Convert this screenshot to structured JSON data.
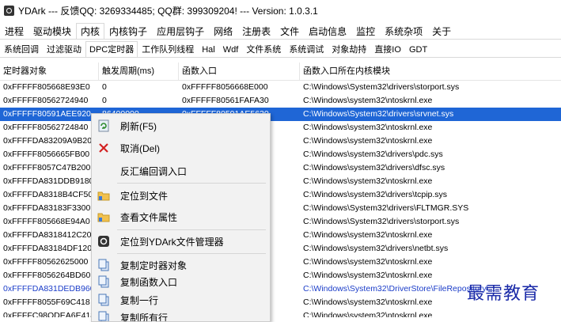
{
  "window": {
    "title": "YDArk --- 反馈QQ: 3269334485; QQ群: 399309204! --- Version: 1.0.3.1"
  },
  "menu": [
    "进程",
    "驱动模块",
    "内核",
    "内核钩子",
    "应用层钩子",
    "网络",
    "注册表",
    "文件",
    "启动信息",
    "监控",
    "系统杂项",
    "关于"
  ],
  "subtabs": [
    "系统回调",
    "过滤驱动",
    "DPC定时器",
    "工作队列线程",
    "Hal",
    "Wdf",
    "文件系统",
    "系统调试",
    "对象劫持",
    "直接IO",
    "GDT"
  ],
  "columns": [
    "定时器对象",
    "触发周期(ms)",
    "函数入口",
    "函数入口所在内核模块"
  ],
  "rows": [
    {
      "obj": "0xFFFFF805668E93E0",
      "period": "0",
      "entry": "0xFFFFF8056668E000",
      "module": "C:\\Windows\\System32\\drivers\\storport.sys"
    },
    {
      "obj": "0xFFFFF80562724940",
      "period": "0",
      "entry": "0xFFFFF80561FAFA30",
      "module": "C:\\Windows\\system32\\ntoskrnl.exe"
    },
    {
      "obj": "0xFFFFF80591AEE920",
      "period": "86400000",
      "entry": "0xFFFFF80591AE5630",
      "module": "C:\\Windows\\System32\\drivers\\srvnet.sys"
    },
    {
      "obj": "0xFFFFF80562724840",
      "period": "",
      "entry": "",
      "module": "C:\\Windows\\system32\\ntoskrnl.exe"
    },
    {
      "obj": "0xFFFFDA83209A9B20",
      "period": "",
      "entry": "",
      "module": "C:\\Windows\\system32\\ntoskrnl.exe"
    },
    {
      "obj": "0xFFFFF8056665FB00",
      "period": "",
      "entry": "",
      "module": "C:\\Windows\\system32\\drivers\\pdc.sys"
    },
    {
      "obj": "0xFFFFF8057C47B200",
      "period": "",
      "entry": "",
      "module": "C:\\Windows\\system32\\drivers\\dfsc.sys"
    },
    {
      "obj": "0xFFFFDA831DDB9180",
      "period": "",
      "entry": "",
      "module": "C:\\Windows\\system32\\ntoskrnl.exe"
    },
    {
      "obj": "0xFFFFDA8318B4CF50",
      "period": "",
      "entry": "",
      "module": "C:\\Windows\\system32\\drivers\\tcpip.sys"
    },
    {
      "obj": "0xFFFFDA83183F3300",
      "period": "",
      "entry": "",
      "module": "C:\\Windows\\System32\\drivers\\FLTMGR.SYS"
    },
    {
      "obj": "0xFFFFF805668E94A0",
      "period": "",
      "entry": "",
      "module": "C:\\Windows\\System32\\drivers\\storport.sys"
    },
    {
      "obj": "0xFFFFDA8318412C20",
      "period": "",
      "entry": "",
      "module": "C:\\Windows\\system32\\ntoskrnl.exe"
    },
    {
      "obj": "0xFFFFDA83184DF120",
      "period": "",
      "entry": "",
      "module": "C:\\Windows\\system32\\drivers\\netbt.sys"
    },
    {
      "obj": "0xFFFFF80562625000",
      "period": "",
      "entry": "",
      "module": "C:\\Windows\\system32\\ntoskrnl.exe"
    },
    {
      "obj": "0xFFFFF8056264BD60",
      "period": "",
      "entry": "",
      "module": "C:\\Windows\\system32\\ntoskrnl.exe"
    },
    {
      "obj": "0xFFFFDA831DEDB960",
      "period": "",
      "entry": "",
      "module": "C:\\Windows\\System32\\DriverStore\\FileRepository\\..."
    },
    {
      "obj": "0xFFFFF8055F69C418",
      "period": "",
      "entry": "",
      "module": "C:\\Windows\\system32\\ntoskrnl.exe"
    },
    {
      "obj": "0xFFFFC98ODEA6E418",
      "period": "",
      "entry": "",
      "module": "C:\\Windows\\system32\\ntoskrnl.exe"
    }
  ],
  "context_menu": {
    "refresh": "刷新(F5)",
    "cancel": "取消(Del)",
    "disasm": "反汇编回调入口",
    "locate_file": "定位到文件",
    "file_props": "查看文件属性",
    "locate_manager": "定位到YDArk文件管理器",
    "copy_obj": "复制定时器对象",
    "copy_entry": "复制函数入口",
    "copy_row": "复制一行",
    "copy_all": "复制所有行"
  },
  "watermark": "最需教育",
  "colors": {
    "selection": "#1f66d6",
    "link_text": "#1a3cc8",
    "watermark": "#1a2aa8"
  }
}
